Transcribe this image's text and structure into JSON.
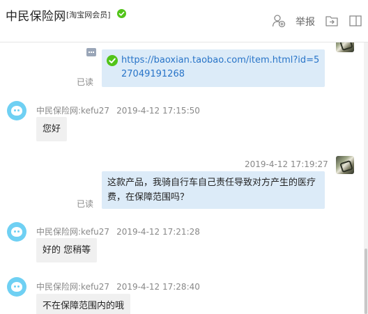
{
  "header": {
    "shop_name": "中民保险网",
    "member_tag": "[淘宝网会员]",
    "report_label": "举报",
    "icons": [
      "verified-check-icon",
      "add-contact-icon",
      "report-flag-icon",
      "folder-share-icon",
      "expand-window-icon"
    ]
  },
  "colors": {
    "accent_link": "#2874c8",
    "outgoing_bubble": "#dcebf8",
    "incoming_bubble": "#f0f0f0",
    "verified_green": "#52c41a",
    "bot_avatar": "#6fd0f3"
  },
  "messages": [
    {
      "direction": "out",
      "type": "link",
      "text": "https://baoxian.taobao.com/item.html?id=527049191268",
      "status": "已读"
    },
    {
      "direction": "in",
      "sender": "中民保险网:kefu27",
      "time": "2019-4-12 17:15:50",
      "text": "您好"
    },
    {
      "direction": "out",
      "time": "2019-4-12 17:19:27",
      "text": "这款产品，我骑自行车自己责任导致对方产生的医疗费，在保障范围吗？",
      "status": "已读"
    },
    {
      "direction": "in",
      "sender": "中民保险网:kefu27",
      "time": "2019-4-12 17:21:28",
      "text": "好的 您稍等"
    },
    {
      "direction": "in",
      "sender": "中民保险网:kefu27",
      "time": "2019-4-12 17:28:40",
      "text": "不在保障范围内的哦"
    }
  ]
}
